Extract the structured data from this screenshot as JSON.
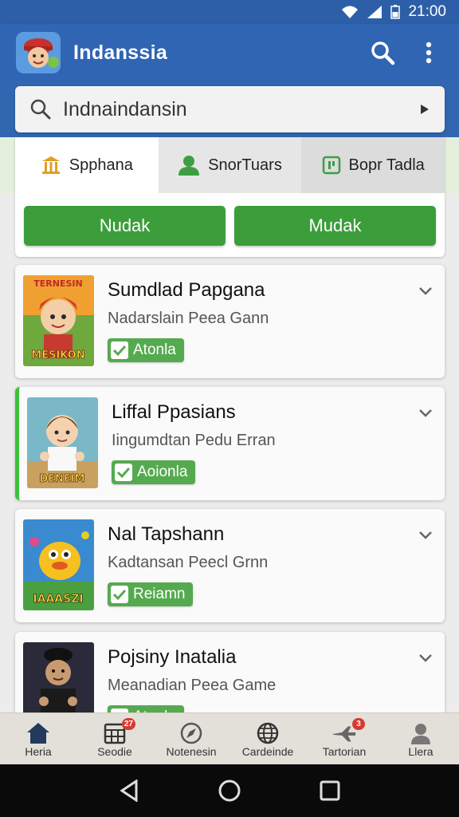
{
  "status": {
    "time": "21:00"
  },
  "app": {
    "title": "Indanssia"
  },
  "search": {
    "value": "Indnaindansin"
  },
  "tabs": [
    {
      "label": "Spphana",
      "icon": "temple-icon"
    },
    {
      "label": "SnorTuars",
      "icon": "person-icon"
    },
    {
      "label": "Bopr Tadla",
      "icon": "book-icon"
    }
  ],
  "actions": {
    "left": "Nudak",
    "right": "Mudak"
  },
  "games": [
    {
      "title": "Sumdlad Papgana",
      "subtitle": "Nadarslain Peea Gann",
      "badge": "Atonla",
      "thumb_top": "TERNESIN",
      "thumb_bottom": "MESIKON"
    },
    {
      "title": "Liffal Ppasians",
      "subtitle": "Iingumdtan Pedu Erran",
      "badge": "Aoionla",
      "thumb_bottom": "DENEIM"
    },
    {
      "title": "Nal Tapshann",
      "subtitle": "Kadtansan Peecl Grnn",
      "badge": "Reiamn",
      "thumb_bottom": "IAAASZI"
    },
    {
      "title": "Pojsiny Inatalia",
      "subtitle": "Meanadian Peea Game",
      "badge": "Atonla"
    }
  ],
  "nav": [
    {
      "label": "Heria",
      "icon": "home-icon"
    },
    {
      "label": "Seodie",
      "icon": "calendar-icon",
      "badge": "27"
    },
    {
      "label": "Notenesin",
      "icon": "compass-icon"
    },
    {
      "label": "Cardeinde",
      "icon": "globe-icon"
    },
    {
      "label": "Tartorian",
      "icon": "plane-icon",
      "badge": "3"
    },
    {
      "label": "Llera",
      "icon": "profile-icon"
    }
  ],
  "colors": {
    "primary": "#2f65b2",
    "accent_green": "#3c9e3a",
    "badge_green": "#55aa4f"
  }
}
